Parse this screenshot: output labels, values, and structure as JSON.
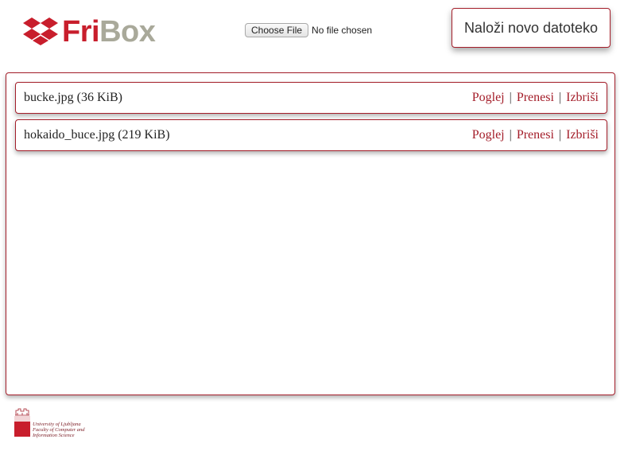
{
  "header": {
    "logo_part1": "Fri",
    "logo_part2": "Box",
    "choose_file_label": "Choose File",
    "no_file_text": "No file chosen",
    "upload_button_label": "Naloži novo datoteko"
  },
  "files": [
    {
      "name": "bucke.jpg (36 KiB)",
      "view_label": "Poglej",
      "download_label": "Prenesi",
      "delete_label": "Izbriši"
    },
    {
      "name": "hokaido_buce.jpg (219 KiB)",
      "view_label": "Poglej",
      "download_label": "Prenesi",
      "delete_label": "Izbriši"
    }
  ],
  "separator": "|",
  "footer": {
    "university_line1": "University of Ljubljana",
    "university_line2": "Faculty of Computer and",
    "university_line3": "Information Science"
  },
  "colors": {
    "accent": "#c81e2c",
    "border": "#a41e2a",
    "logo_gray": "#a9a99a"
  },
  "icons": {
    "logo_mark": "dropbox-style-box-icon",
    "footer_logo": "university-seal-icon"
  }
}
